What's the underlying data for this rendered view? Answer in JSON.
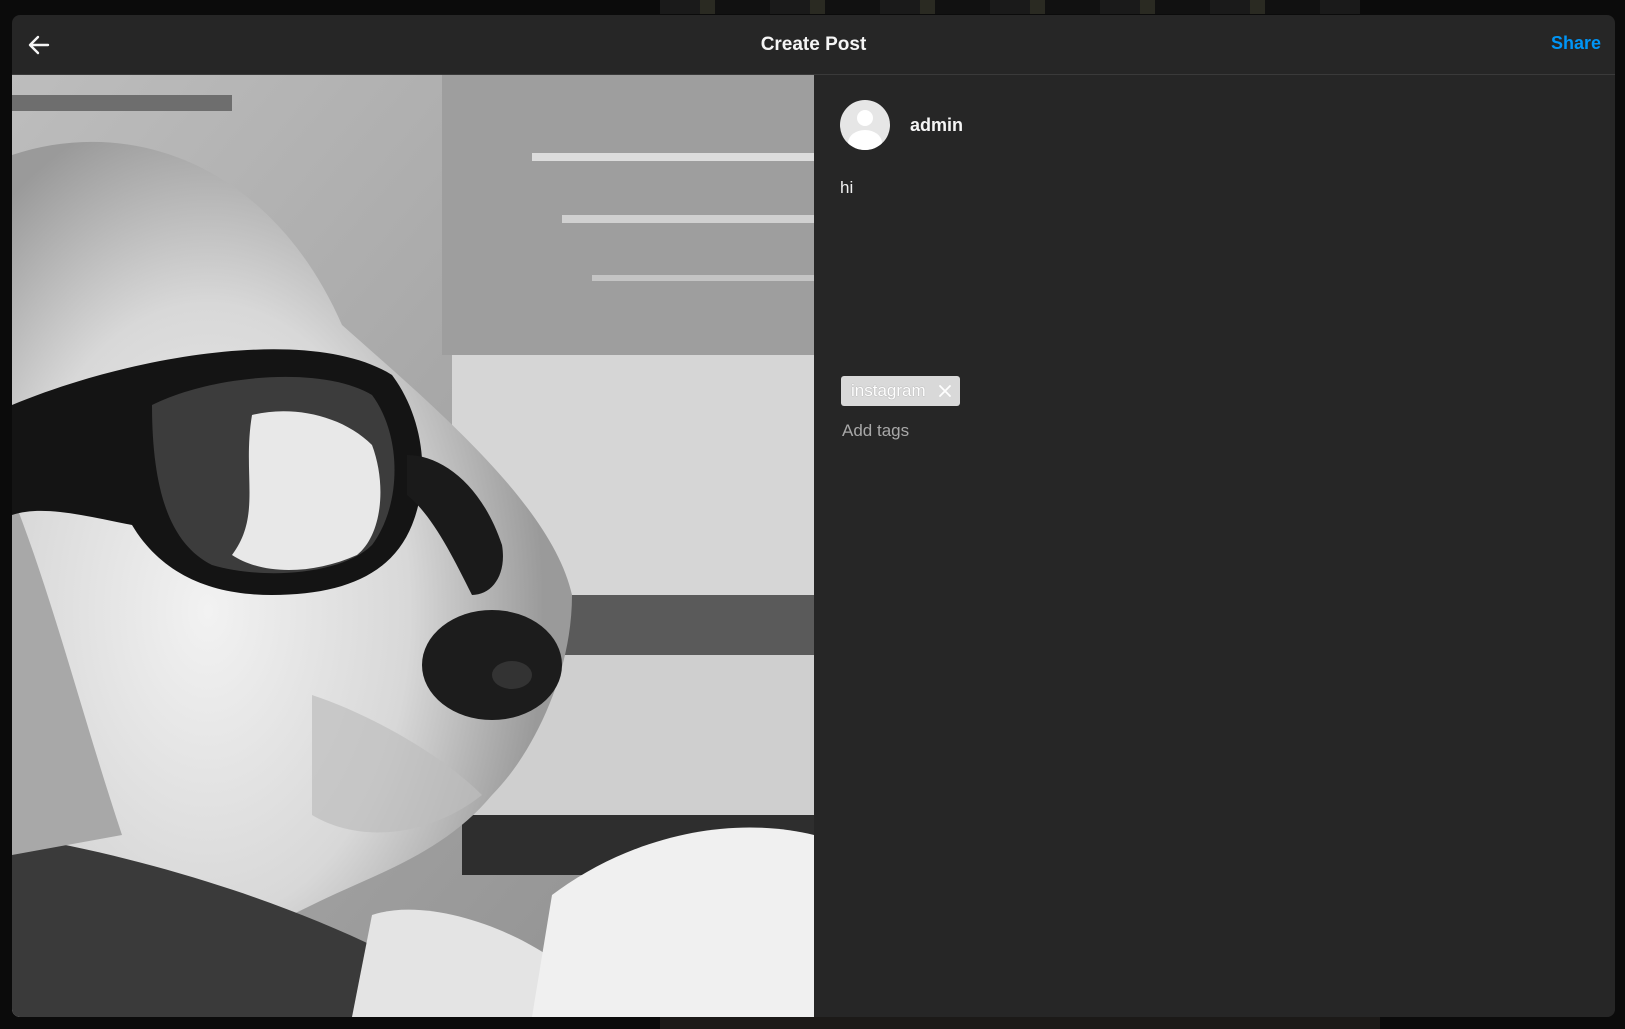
{
  "header": {
    "title": "Create Post",
    "share_label": "Share",
    "back_icon": "arrow-left-icon",
    "accent_color": "#0095f6"
  },
  "media": {
    "description_icon": "image-preview"
  },
  "user": {
    "username": "admin",
    "avatar_icon": "default-avatar-icon"
  },
  "caption": {
    "text": "hi"
  },
  "tags": {
    "items": [
      {
        "label": "instagram",
        "remove_icon": "close-icon"
      }
    ],
    "placeholder": "Add tags"
  }
}
